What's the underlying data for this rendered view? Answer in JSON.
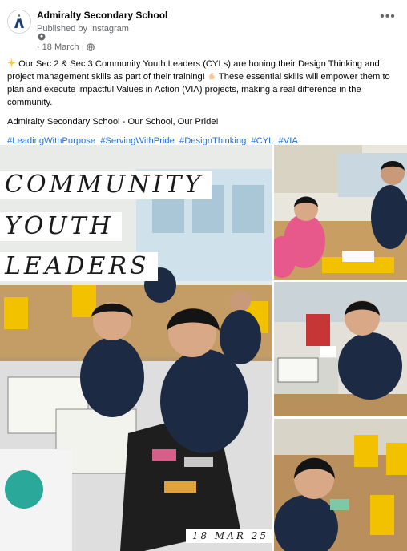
{
  "post": {
    "page_name": "Admiralty Secondary School",
    "published_by": "Published by Instagram",
    "date": "18 March",
    "separator": "·",
    "more_label": "•••"
  },
  "body": {
    "paragraph_1_text": "Our Sec 2 & Sec 3 Community Youth Leaders (CYLs) are honing their Design Thinking and project management skills as part of their training!",
    "paragraph_1_text_2": "These essential skills will empower them to plan and execute impactful Values in Action (VIA) projects, making a real difference in the community.",
    "paragraph_2": "Admiralty Secondary School - Our School, Our Pride!",
    "hashtags": [
      "#LeadingWithPurpose",
      "#ServingWithPride",
      "#DesignThinking",
      "#CYL",
      "#VIA"
    ]
  },
  "photo": {
    "banner_line_1": "COMMUNITY",
    "banner_line_2": "YOUTH",
    "banner_line_3": "LEADERS",
    "date_stamp": "18 MAR 25"
  },
  "icons": {
    "avatar": "school-crest-icon",
    "location": "location-pin-icon",
    "audience": "globe-icon",
    "sparkle": "sparkle-emoji-icon",
    "muscle": "flexed-biceps-emoji-icon",
    "more": "more-options-icon"
  },
  "colors": {
    "hashtag": "#216fdb",
    "secondary_text": "#65676b"
  }
}
